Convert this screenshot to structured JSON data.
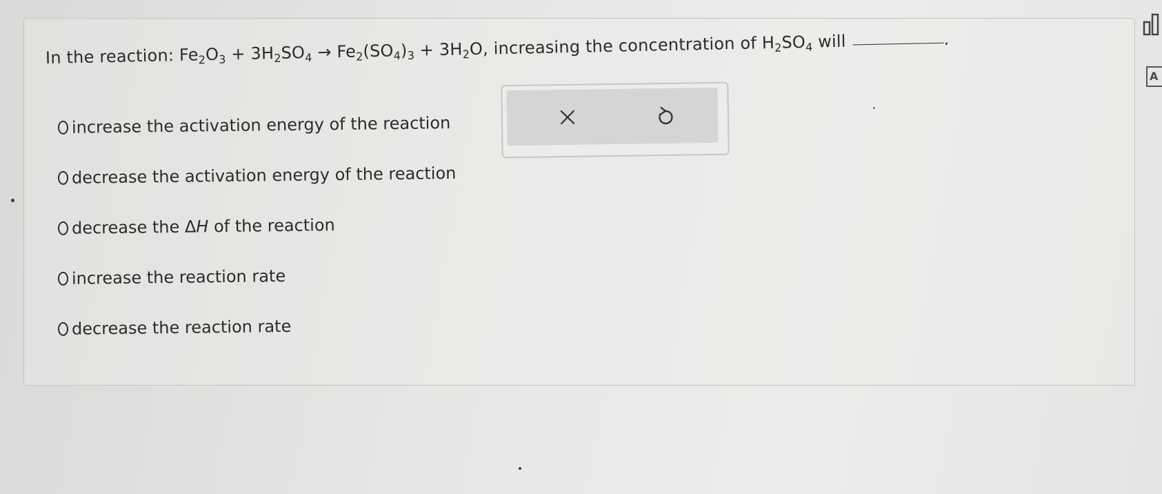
{
  "question": {
    "prefix": "In the reaction: ",
    "eq_fe": "Fe",
    "eq_fe_sub": "2",
    "eq_o": "O",
    "eq_o_sub": "3",
    "eq_plus1": " + 3H",
    "eq_h_sub": "2",
    "eq_so": "SO",
    "eq_so_sub": "4",
    "eq_arrow": " → Fe",
    "eq_fe2_sub": "2",
    "eq_paren": "(SO",
    "eq_paren_sub": "4",
    "eq_paren_close": ")",
    "eq_paren_close_sub": "3",
    "eq_plus2": " + 3H",
    "eq_h2_sub": "2",
    "eq_water": "O, increasing the concentration of H",
    "eq_h3_sub": "2",
    "eq_so2": "SO",
    "eq_so2_sub": "4",
    "suffix": " will",
    "period": "."
  },
  "options": [
    {
      "label": "increase the activation energy of the reaction"
    },
    {
      "label": "decrease the activation energy of the reaction"
    },
    {
      "label_pre": "decrease the ΔH of the reaction",
      "label": "decrease the ",
      "delta": "Δ",
      "italic": "H",
      "label_post": " of the reaction"
    },
    {
      "label": "increase the reaction rate"
    },
    {
      "label": "decrease the reaction rate"
    }
  ],
  "tools": {
    "clear_icon": "x-icon",
    "undo_icon": "undo-icon"
  },
  "side": {
    "chart_icon": "bar-chart-icon",
    "text_icon_label": "A"
  }
}
